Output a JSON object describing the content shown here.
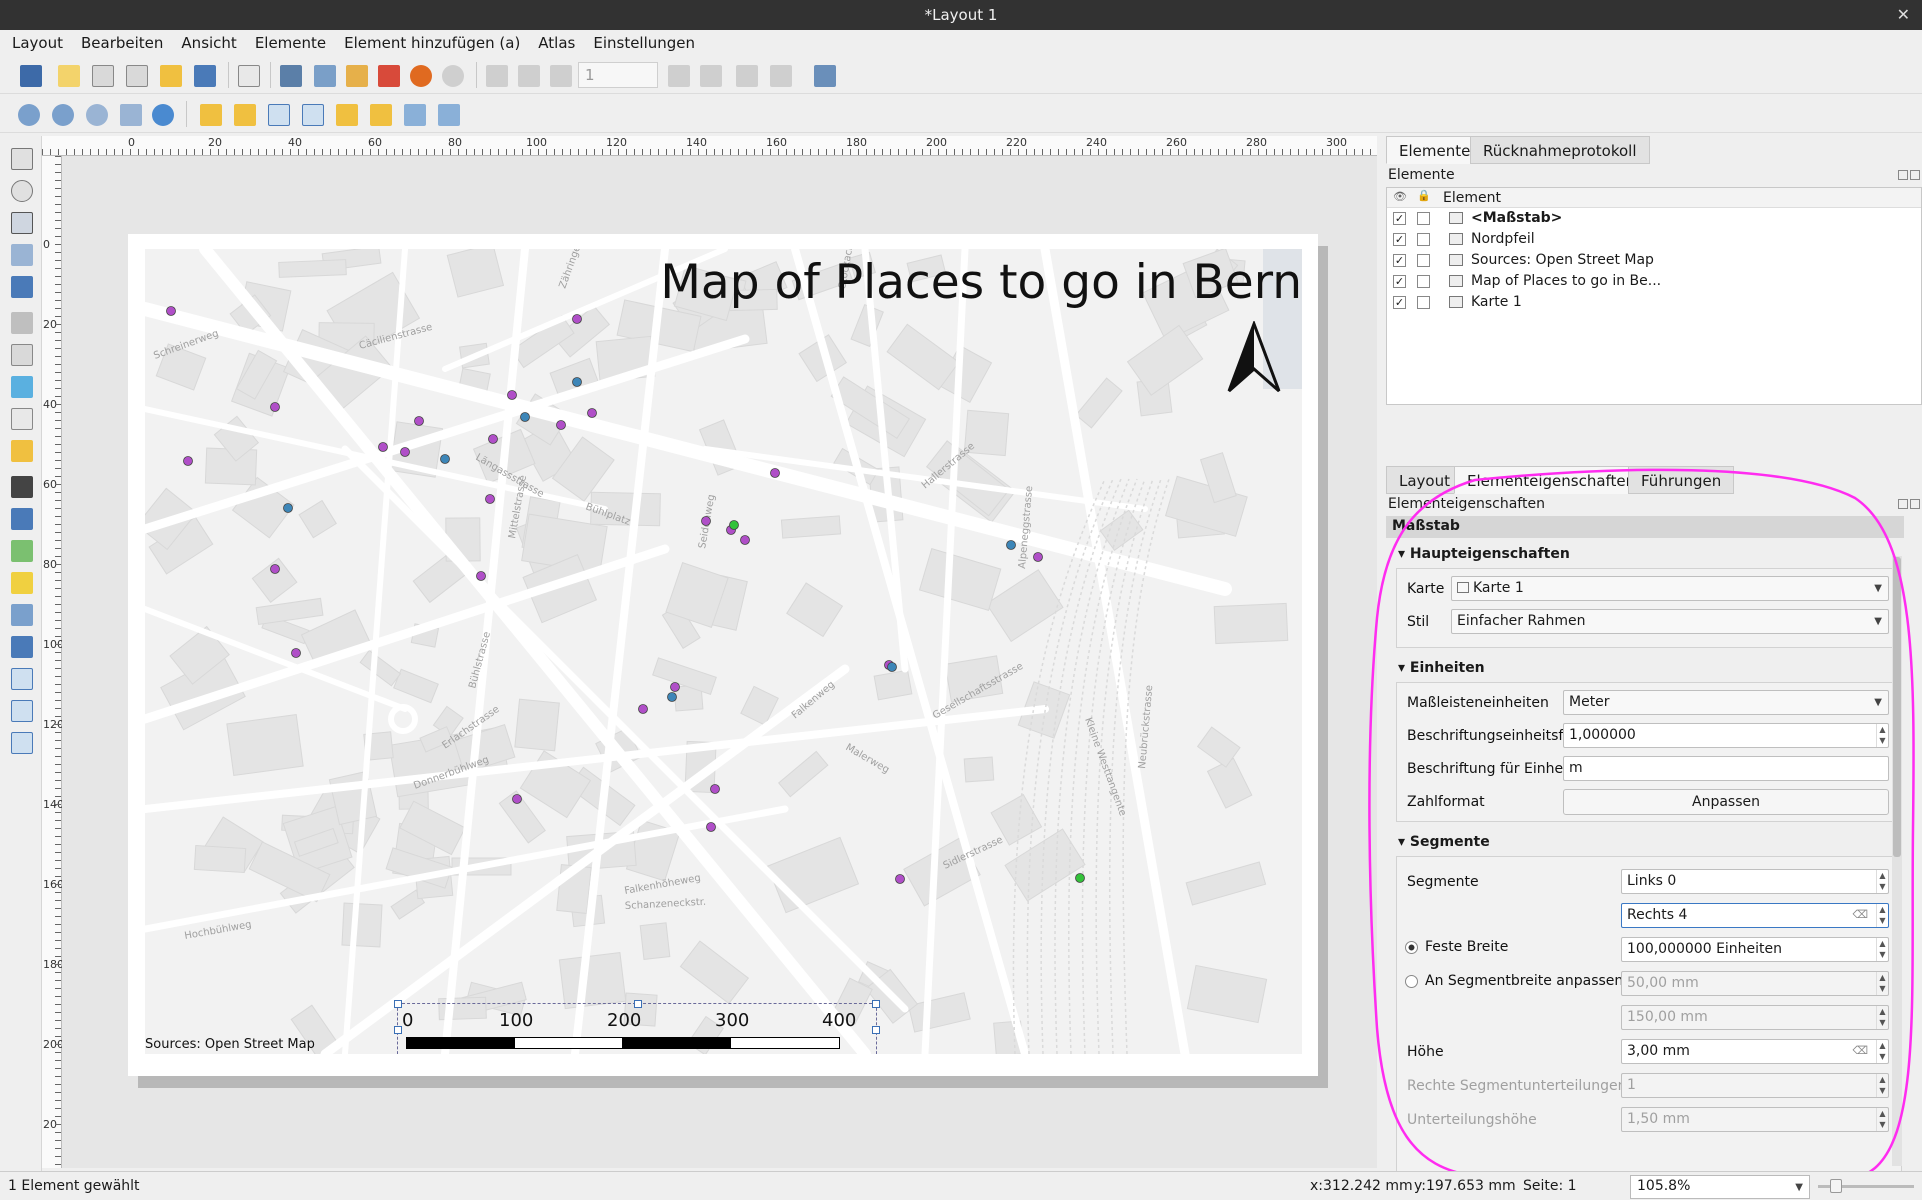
{
  "window": {
    "title": "*Layout 1"
  },
  "menu": [
    "Layout",
    "Bearbeiten",
    "Ansicht",
    "Elemente",
    "Element hinzufügen (a)",
    "Atlas",
    "Einstellungen"
  ],
  "toolbar": {
    "page_number": "1"
  },
  "ruler": {
    "h_ticks": [
      "0",
      "20",
      "40",
      "60",
      "80",
      "100",
      "120",
      "140",
      "160",
      "180",
      "200",
      "220",
      "240",
      "260",
      "280",
      "300"
    ],
    "v_ticks": [
      "0",
      "20",
      "40",
      "60",
      "80",
      "100",
      "120",
      "140",
      "160",
      "180",
      "200",
      "20"
    ]
  },
  "layout": {
    "title": "Map of Places to go in Bern",
    "sources": "Sources: Open Street Map",
    "scalebar": {
      "labels": [
        "0",
        "100",
        "200",
        "300",
        "400 m"
      ],
      "segments": 4
    },
    "street_labels": [
      "Schreinerweg",
      "Zähringerstrasse",
      "Cäcilienstrasse",
      "Stöckackerstrasse",
      "Längassstrasse",
      "Mittelstrasse",
      "Bühlstrasse",
      "Erlachstrasse",
      "Donnerbühlweg",
      "Falkenhöheweg",
      "Schanzeneckstr.",
      "Seidenweg",
      "Hallerstrasse",
      "Gesellschaftsstrasse",
      "Alpeneggstrasse",
      "Kleine Westtangente",
      "Neubrückstrasse",
      "Sidlerstrasse",
      "Bühlplatz",
      "Hochbühlweg",
      "Falkenweg",
      "Malerweg"
    ]
  },
  "colors": {
    "poi_purple": "#b04fc8",
    "poi_blue": "#3d86b8",
    "poi_green": "#33c23a",
    "annotation": "#ff2cf0"
  },
  "right_panel": {
    "tabs": [
      "Elemente",
      "Rücknahmeprotokoll"
    ],
    "elements_title": "Elemente",
    "list_header": "Element",
    "items": [
      {
        "label": "<Maßstab>",
        "visible": true,
        "locked": false,
        "icon": "scalebar-icon",
        "bold": true
      },
      {
        "label": "Nordpfeil",
        "visible": true,
        "locked": false,
        "icon": "picture-icon"
      },
      {
        "label": "Sources: Open Street Map",
        "visible": true,
        "locked": false,
        "icon": "label-icon"
      },
      {
        "label": "Map of Places to go in Be...",
        "visible": true,
        "locked": false,
        "icon": "label-icon"
      },
      {
        "label": "Karte 1",
        "visible": true,
        "locked": false,
        "icon": "map-icon"
      }
    ],
    "prop_tabs": [
      "Layout",
      "Elementeigenschaften",
      "Führungen"
    ],
    "props_title": "Elementeigenschaften",
    "props_head": "Maßstab",
    "main": {
      "title": "Haupteigenschaften",
      "karte_label": "Karte",
      "karte_value": "Karte 1",
      "stil_label": "Stil",
      "stil_value": "Einfacher Rahmen"
    },
    "units": {
      "title": "Einheiten",
      "bar_units_label": "Maßleisteneinheiten",
      "bar_units_value": "Meter",
      "factor_label": "Beschriftungseinheitsfaktor",
      "factor_value": "1,000000",
      "unit_label_label": "Beschriftung für Einheiten",
      "unit_label_value": "m",
      "format_label": "Zahlformat",
      "format_button": "Anpassen"
    },
    "segments": {
      "title": "Segmente",
      "segments_label": "Segmente",
      "left_value": "Links 0",
      "right_value": "Rechts 4",
      "fixed_width_label": "Feste Breite",
      "fixed_width_value": "100,000000 Einheiten",
      "fit_label": "An Segmentbreite anpassen",
      "fit_min": "50,00 mm",
      "fit_max": "150,00 mm",
      "height_label": "Höhe",
      "height_value": "3,00 mm",
      "right_subdiv_label": "Rechte Segmentunterteilungen",
      "right_subdiv_value": "1",
      "subdiv_height_label": "Unterteilungshöhe",
      "subdiv_height_value": "1,50 mm"
    }
  },
  "status": {
    "selection": "1 Element gewählt",
    "x": "x:312.242 mm",
    "y": "y:197.653 mm",
    "page": "Seite: 1",
    "zoom": "105.8%"
  }
}
